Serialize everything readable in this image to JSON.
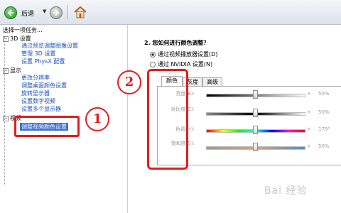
{
  "toolbar": {
    "back_label": "后退",
    "dropdown_icon": "chevron-down-icon",
    "home_icon": "home-icon"
  },
  "sidebar": {
    "title": "选择一项任务...",
    "categories": [
      {
        "label": "3D 设置",
        "items": [
          "通过预览调整图像设置",
          "管理 3D 设置",
          "设置 PhysX 配置"
        ]
      },
      {
        "label": "显示",
        "items": [
          "更改分辨率",
          "调整桌面颜色设置",
          "旋转显示器",
          "设置数字视频",
          "设置多个显示器"
        ]
      },
      {
        "label": "视频",
        "items": [
          "调整视频颜色设置"
        ]
      }
    ]
  },
  "main": {
    "question": "2. 您如何进行颜色调整？",
    "options": [
      {
        "label": "通过视频播放器设置(D)",
        "selected": true
      },
      {
        "label": "通过 NVIDIA 设置(N)",
        "selected": false
      }
    ],
    "tabs": [
      "颜色",
      "灰度",
      "高级"
    ],
    "active_tab": "颜色",
    "sliders": [
      {
        "label": "亮度(B):",
        "value": "50%",
        "level": 50
      },
      {
        "label": "对比度(C):",
        "value": "50%",
        "level": 50
      },
      {
        "label": "色调(H):",
        "value": "179°",
        "level": 50
      },
      {
        "label": "饱和度(S):",
        "value": "50%",
        "level": 50
      }
    ]
  },
  "annotations": {
    "marker_1": "1",
    "marker_2": "2",
    "color": "#e21d1d"
  },
  "watermark": "Bai 经验"
}
